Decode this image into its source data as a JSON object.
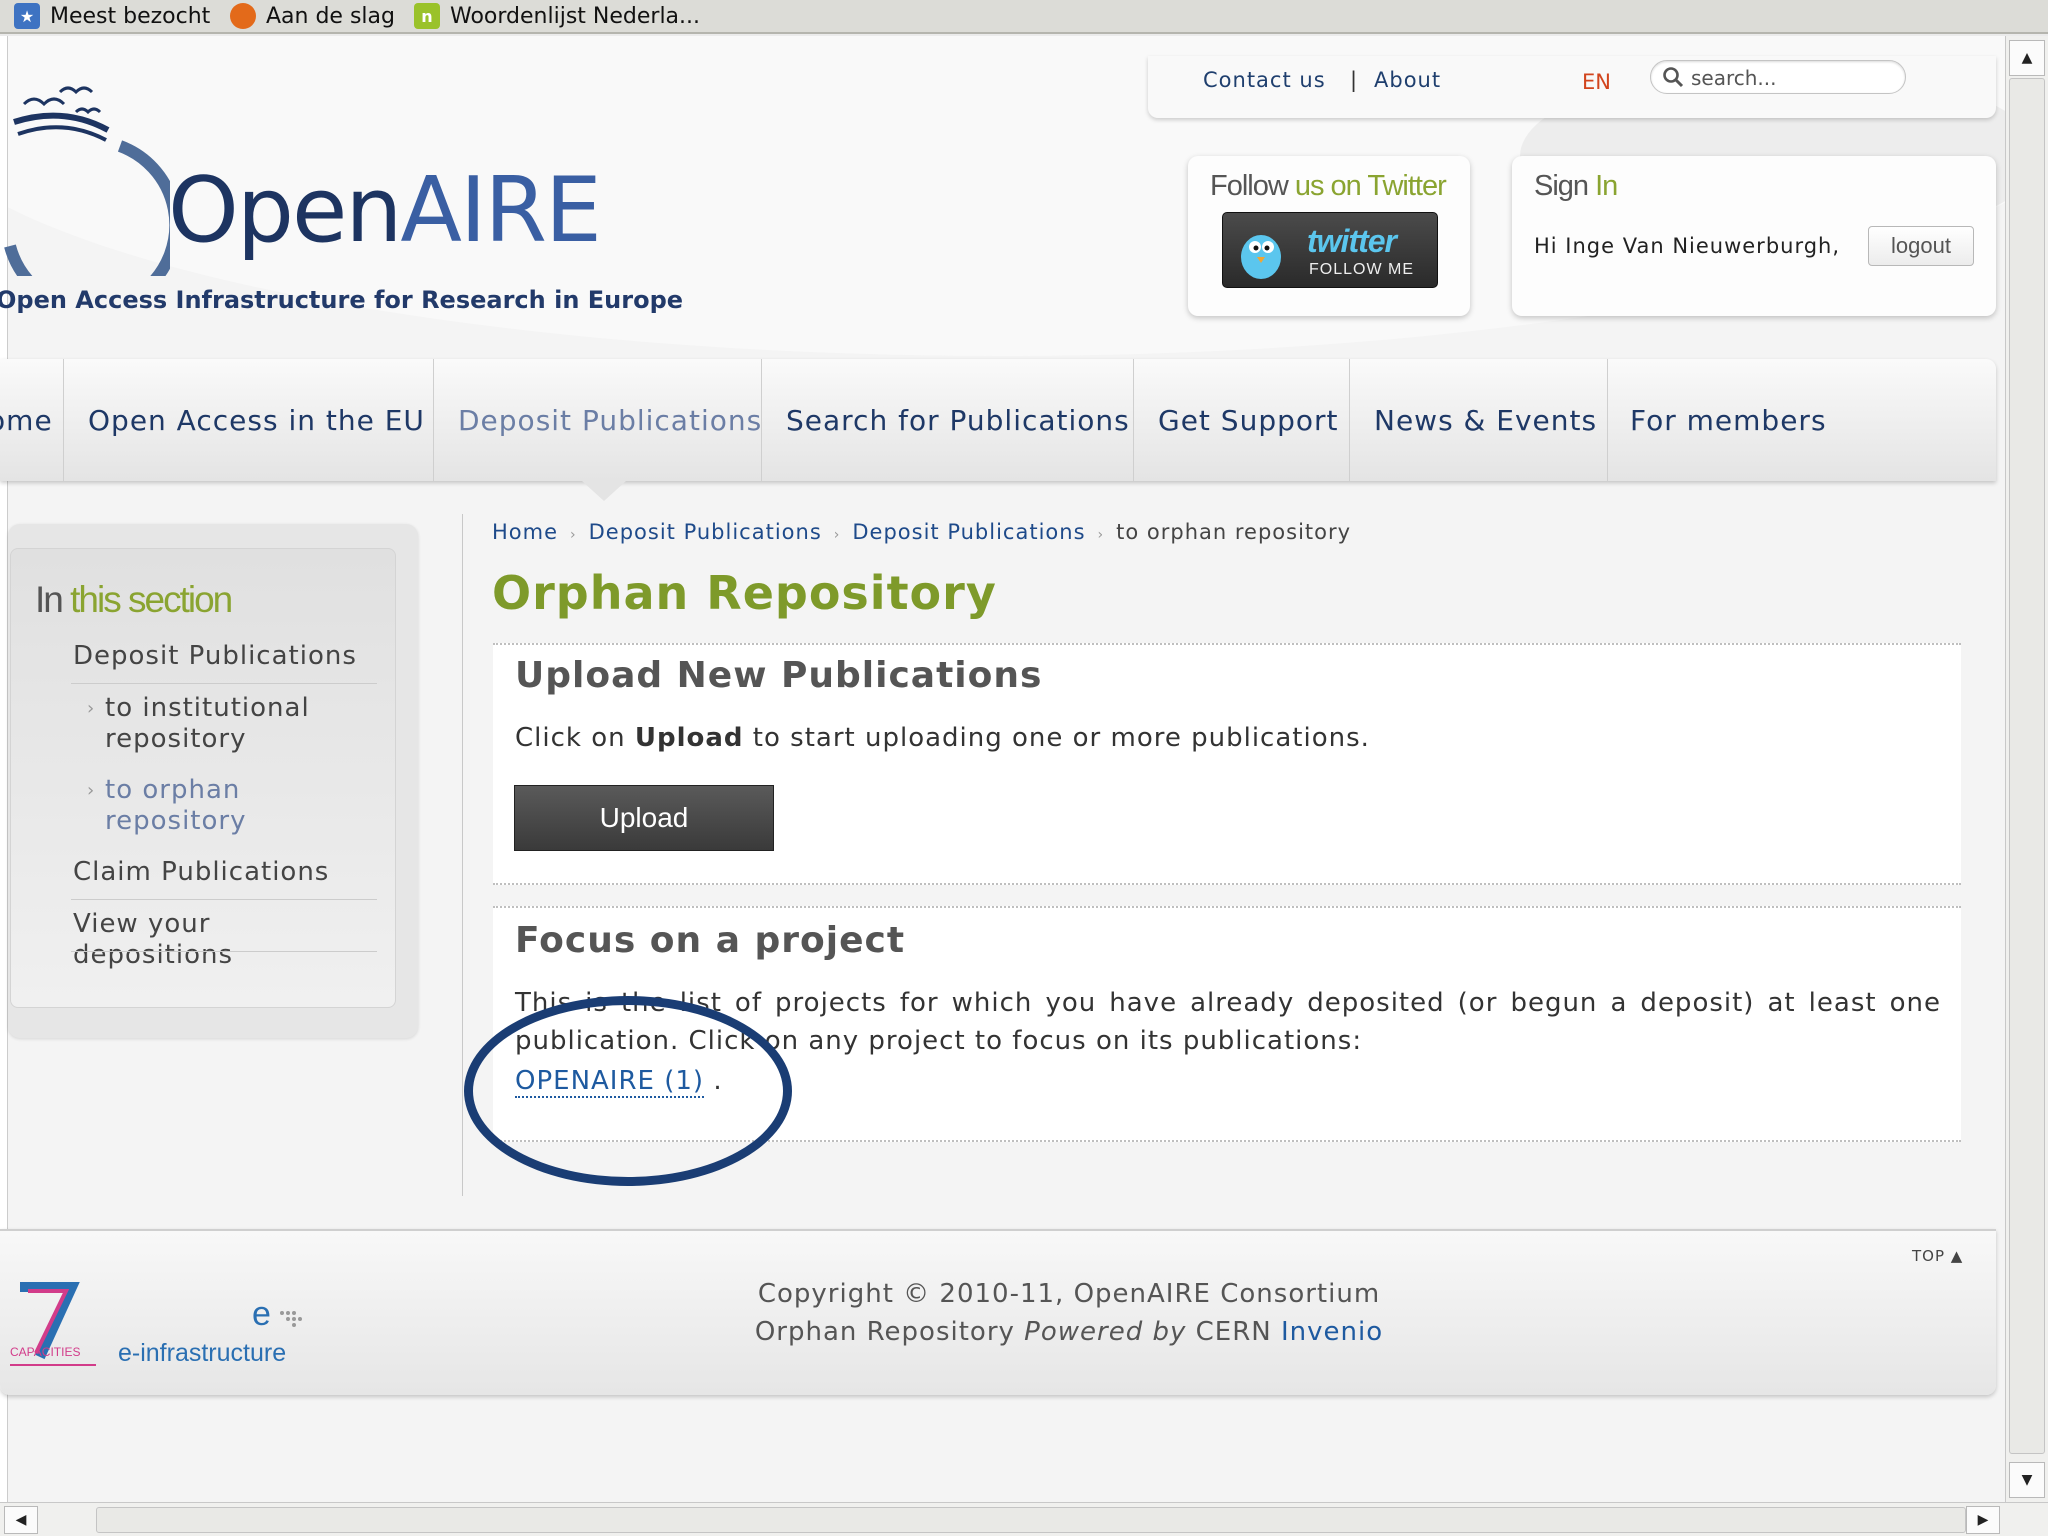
{
  "browser": {
    "bookmarks": [
      {
        "label": "Meest bezocht",
        "icon": "bookmark-icon"
      },
      {
        "label": "Aan de slag",
        "icon": "firefox-icon"
      },
      {
        "label": "Woordenlijst Nederla...",
        "icon": "nl-icon"
      }
    ]
  },
  "header": {
    "top_links": [
      "Contact us",
      "About"
    ],
    "top_separator": "|",
    "language": "EN",
    "search_placeholder": "search...",
    "logo_open": "Open",
    "logo_aire": "AIRE",
    "tagline": "Open Access Infrastructure for Research in Europe"
  },
  "twitter_panel": {
    "title_a": "Follow ",
    "title_b": "us on Twitter",
    "badge_word": "twitter",
    "badge_follow": "FOLLOW ME"
  },
  "signin_panel": {
    "title_a": "Sign ",
    "title_b": "In",
    "greeting": "Hi Inge Van Nieuwerburgh,",
    "logout_label": "logout"
  },
  "nav": {
    "items": [
      "Home",
      "Open Access in the EU",
      "Deposit Publications",
      "Search for Publications",
      "Get Support",
      "News & Events",
      "For members"
    ],
    "active": "Deposit Publications"
  },
  "sidebar": {
    "title_a": "In ",
    "title_b": "this section",
    "items": [
      {
        "label": "Deposit Publications"
      },
      {
        "label": "to institutional repository",
        "sub": true
      },
      {
        "label": "to orphan repository",
        "sub": true,
        "active": true
      },
      {
        "label": "Claim Publications"
      },
      {
        "label": "View your depositions"
      }
    ]
  },
  "breadcrumb": [
    "Home",
    "Deposit Publications",
    "Deposit Publications",
    "to orphan repository"
  ],
  "main": {
    "title": "Orphan Repository",
    "upload_section": {
      "heading": "Upload New Publications",
      "text_before": "Click on ",
      "text_bold": "Upload",
      "text_after": " to start uploading one or more publications.",
      "button_label": "Upload"
    },
    "focus_section": {
      "heading": "Focus on a project",
      "text": "This is the list of projects for which you have already deposited (or begun a deposit) at least one publication. Click on any project to focus on its publications:",
      "project_link": "OPENAIRE (1)",
      "after_link": " ."
    }
  },
  "footer": {
    "top_label": "TOP",
    "copyright": "Copyright © 2010-11, OpenAIRE Consortium",
    "powered_a": "Orphan Repository ",
    "powered_b": "Powered by",
    "powered_c": " CERN ",
    "powered_d": "Invenio",
    "fp7_label": "CAPACITIES",
    "einfra_label": "e-infrastructure"
  },
  "colors": {
    "brand_blue": "#1d3461",
    "accent_green": "#8aa431",
    "link_blue": "#1e5aa0",
    "language_orange": "#d2451e",
    "annotation_circle": "#1a3d74"
  }
}
